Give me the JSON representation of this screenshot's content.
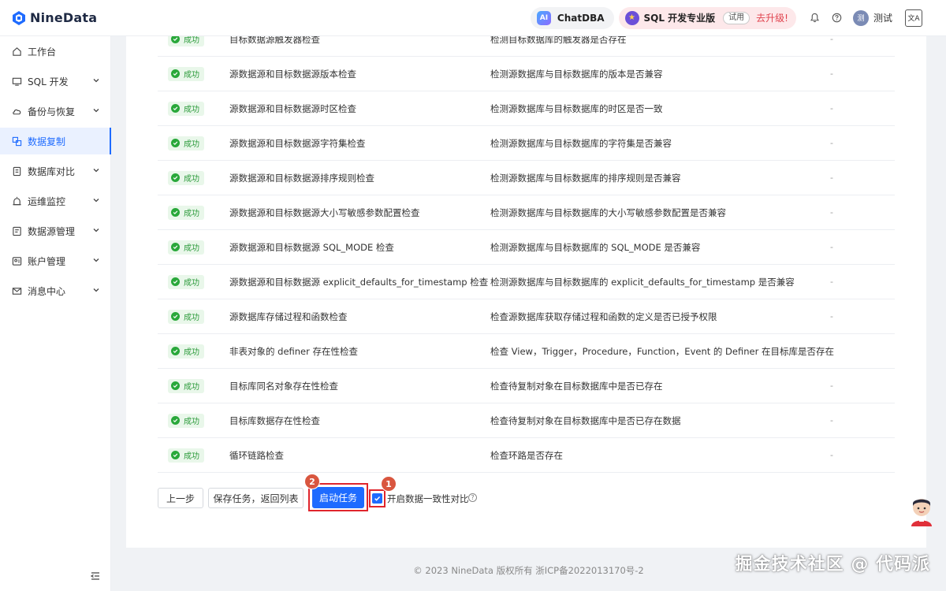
{
  "app": {
    "name": "NineData"
  },
  "header": {
    "chatdba": {
      "icon_text": "AI",
      "label": "ChatDBA"
    },
    "sql_pro": {
      "label": "SQL 开发专业版",
      "trial": "试用",
      "upgrade": "去升级!"
    },
    "user": {
      "avatar_text": "测",
      "name": "测试"
    },
    "lang_icon_text": "文A"
  },
  "sidebar": {
    "items": [
      {
        "label": "工作台",
        "icon": "home-icon",
        "expandable": false,
        "active": false
      },
      {
        "label": "SQL 开发",
        "icon": "monitor-icon",
        "expandable": true,
        "active": false
      },
      {
        "label": "备份与恢复",
        "icon": "cloud-icon",
        "expandable": true,
        "active": false
      },
      {
        "label": "数据复制",
        "icon": "replicate-icon",
        "expandable": false,
        "active": true
      },
      {
        "label": "数据库对比",
        "icon": "compare-icon",
        "expandable": true,
        "active": false
      },
      {
        "label": "运维监控",
        "icon": "alarm-icon",
        "expandable": true,
        "active": false
      },
      {
        "label": "数据源管理",
        "icon": "datasource-icon",
        "expandable": true,
        "active": false
      },
      {
        "label": "账户管理",
        "icon": "account-icon",
        "expandable": true,
        "active": false
      },
      {
        "label": "消息中心",
        "icon": "mail-icon",
        "expandable": true,
        "active": false
      }
    ]
  },
  "checks": {
    "status_label": "成功",
    "rows": [
      {
        "name": "目标数据源触发器检查",
        "desc": "检测目标数据库的触发器是否存在",
        "extra": "-"
      },
      {
        "name": "源数据源和目标数据源版本检查",
        "desc": "检测源数据库与目标数据库的版本是否兼容",
        "extra": "-"
      },
      {
        "name": "源数据源和目标数据源时区检查",
        "desc": "检测源数据库与目标数据库的时区是否一致",
        "extra": "-"
      },
      {
        "name": "源数据源和目标数据源字符集检查",
        "desc": "检测源数据库与目标数据库的字符集是否兼容",
        "extra": "-"
      },
      {
        "name": "源数据源和目标数据源排序规则检查",
        "desc": "检测源数据库与目标数据库的排序规则是否兼容",
        "extra": "-"
      },
      {
        "name": "源数据源和目标数据源大小写敏感参数配置检查",
        "desc": "检测源数据库与目标数据库的大小写敏感参数配置是否兼容",
        "extra": "-"
      },
      {
        "name": "源数据源和目标数据源 SQL_MODE 检查",
        "desc": "检测源数据库与目标数据库的 SQL_MODE 是否兼容",
        "extra": "-"
      },
      {
        "name": "源数据源和目标数据源 explicit_defaults_for_timestamp 检查",
        "desc": "检测源数据库与目标数据库的 explicit_defaults_for_timestamp 是否兼容",
        "extra": "-"
      },
      {
        "name": "源数据库存储过程和函数检查",
        "desc": "检查源数据库获取存储过程和函数的定义是否已授予权限",
        "extra": "-"
      },
      {
        "name": "非表对象的 definer 存在性检查",
        "desc": "检查 View，Trigger，Procedure，Function，Event 的 Definer 在目标库是否存在",
        "extra": "-"
      },
      {
        "name": "目标库同名对象存在性检查",
        "desc": "检查待复制对象在目标数据库中是否已存在",
        "extra": "-"
      },
      {
        "name": "目标库数据存在性检查",
        "desc": "检查待复制对象在目标数据库中是否已存在数据",
        "extra": "-"
      },
      {
        "name": "循环链路检查",
        "desc": "检查环路是否存在",
        "extra": "-"
      }
    ]
  },
  "actions": {
    "prev": "上一步",
    "save_return": "保存任务，返回列表",
    "start": "启动任务",
    "consistency_label": "开启数据一致性对比",
    "consistency_checked": true,
    "help_icon_text": "?",
    "annotation_1": "1",
    "annotation_2": "2"
  },
  "footer": {
    "text": "© 2023 NineData 版权所有   浙ICP备2022013170号-2"
  },
  "watermark": "掘金技术社区 @ 代码派",
  "colors": {
    "primary": "#1e6bff",
    "success": "#29a83a",
    "highlight": "#e0252c",
    "annotation": "#d9563f"
  }
}
